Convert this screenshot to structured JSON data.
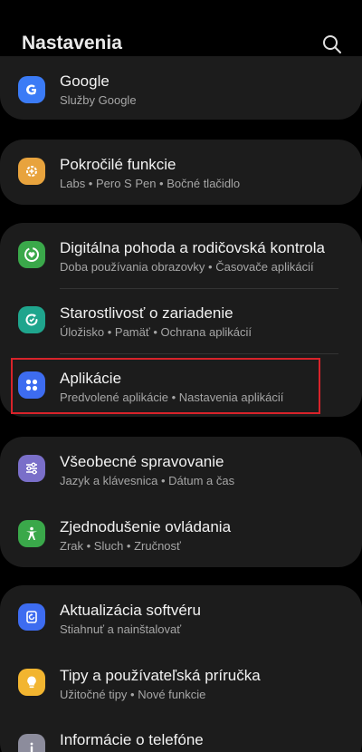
{
  "header": {
    "title": "Nastavenia"
  },
  "items": {
    "google": {
      "title": "Google",
      "subtitle": "Služby Google"
    },
    "advanced": {
      "title": "Pokročilé funkcie",
      "subtitle": "Labs  •  Pero S Pen  •  Bočné tlačidlo"
    },
    "wellbeing": {
      "title": "Digitálna pohoda a rodičovská kontrola",
      "subtitle": "Doba používania obrazovky  •  Časovače aplikácií"
    },
    "devicecare": {
      "title": "Starostlivosť o zariadenie",
      "subtitle": "Úložisko  •  Pamäť  •  Ochrana aplikácií"
    },
    "apps": {
      "title": "Aplikácie",
      "subtitle": "Predvolené aplikácie  •  Nastavenia aplikácií"
    },
    "general": {
      "title": "Všeobecné spravovanie",
      "subtitle": "Jazyk a klávesnica  •  Dátum a čas"
    },
    "accessibility": {
      "title": "Zjednodušenie ovládania",
      "subtitle": "Zrak  •  Sluch  •  Zručnosť"
    },
    "update": {
      "title": "Aktualizácia softvéru",
      "subtitle": "Stiahnuť a nainštalovať"
    },
    "tips": {
      "title": "Tipy a používateľská príručka",
      "subtitle": "Užitočné tipy  •  Nové funkcie"
    },
    "about": {
      "title": "Informácie o telefóne"
    }
  },
  "colors": {
    "background": "#000000",
    "card": "#1c1c1c",
    "highlight": "#d8232a",
    "google_icon": "#3b7bf6",
    "advanced_icon": "#e8a33d",
    "wellbeing_icon": "#3aa84a",
    "devicecare_icon": "#1fa58d",
    "apps_icon": "#3d6cf0",
    "general_icon": "#7a6fc9",
    "accessibility_icon": "#3aa84a",
    "update_icon": "#3d6cf0",
    "tips_icon": "#f2b530",
    "about_icon": "#8c8c9c"
  },
  "icons": {
    "search": "magnifier-icon",
    "google": "google-g-icon",
    "advanced": "gear-plus-icon",
    "wellbeing": "heart-ring-icon",
    "devicecare": "refresh-ring-icon",
    "apps": "four-dots-icon",
    "general": "sliders-icon",
    "accessibility": "person-icon",
    "update": "update-arrow-icon",
    "tips": "lightbulb-icon",
    "about": "info-icon"
  }
}
